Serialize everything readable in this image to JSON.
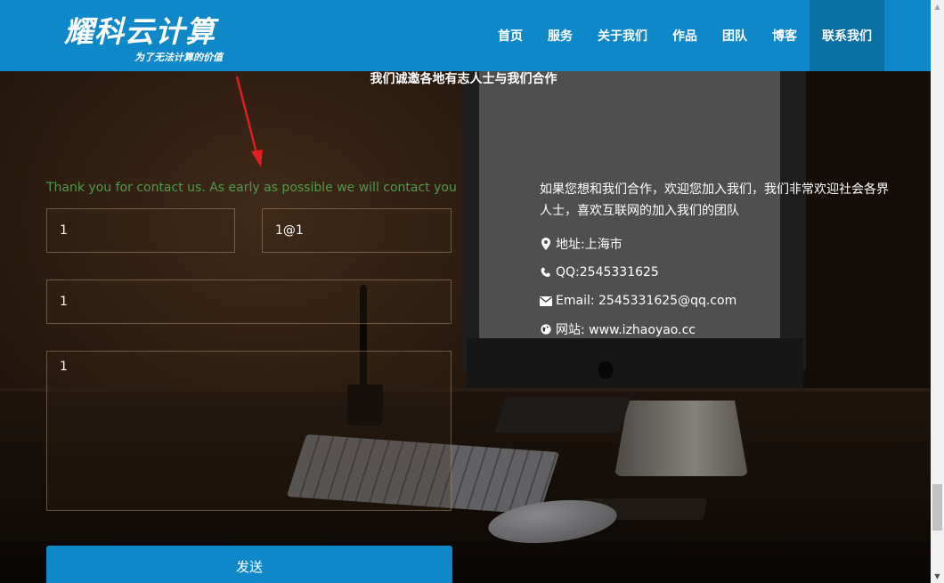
{
  "header": {
    "logo_title": "耀科云计算",
    "logo_tagline": "为了无法计算的价值",
    "nav": [
      {
        "label": "首页",
        "active": false
      },
      {
        "label": "服务",
        "active": false
      },
      {
        "label": "关于我们",
        "active": false
      },
      {
        "label": "作品",
        "active": false
      },
      {
        "label": "团队",
        "active": false
      },
      {
        "label": "博客",
        "active": false
      },
      {
        "label": "联系我们",
        "active": true
      }
    ],
    "background_color": "#0e88c8",
    "active_color": "#0a6fa3"
  },
  "section": {
    "subtitle": "我们诚邀各地有志人士与我们合作"
  },
  "form": {
    "success_message": "Thank you for contact us. As early as possible we will contact you",
    "success_color": "#4f9a4c",
    "name_value": "1",
    "email_value": "1@1",
    "subject_value": "1",
    "message_value": "1",
    "send_label": "发送"
  },
  "contact": {
    "intro": "如果您想和我们合作，欢迎您加入我们，我们非常欢迎社会各界人士，喜欢互联网的加入我们的团队",
    "address": "地址:上海市",
    "qq": "QQ:2545331625",
    "email": "Email: 2545331625@qq.com",
    "website": "网站: www.izhaoyao.cc"
  },
  "annotation": {
    "arrow_color": "#e0201e"
  },
  "icons": {
    "address": "map-marker-icon",
    "qq": "phone-icon",
    "email": "envelope-icon",
    "website": "globe-icon"
  }
}
